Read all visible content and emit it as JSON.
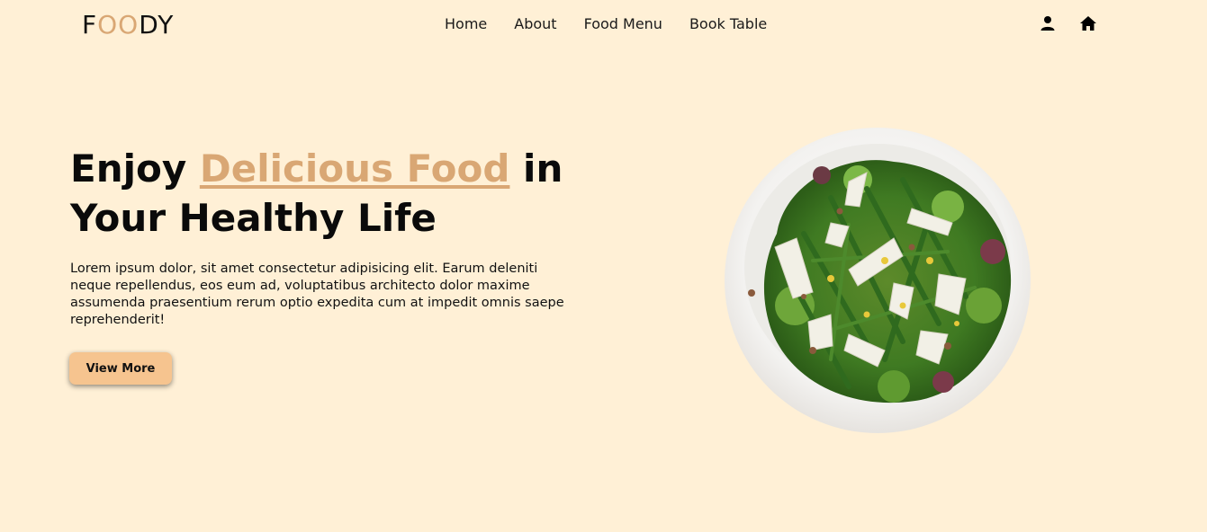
{
  "header": {
    "logo": {
      "prefix": "F",
      "accent": "OO",
      "suffix": "DY"
    },
    "nav": [
      "Home",
      "About",
      "Food Menu",
      "Book Table"
    ],
    "icons": [
      "user-icon",
      "home-icon"
    ]
  },
  "hero": {
    "title_before": "Enjoy ",
    "title_highlight": "Delicious Food",
    "title_after": " in Your Healthy Life",
    "description": "Lorem ipsum dolor, sit amet consectetur adipisicing elit. Earum deleniti neque repellendus, eos eum ad, voluptatibus architecto dolor maxime assumenda praesentium rerum optio expedita cum at impedit omnis saepe reprehenderit!",
    "button_label": "View More",
    "image": "salad-plate-image"
  },
  "colors": {
    "background": "#fff0d6",
    "accent": "#d9a774",
    "button": "#f6c48f"
  }
}
